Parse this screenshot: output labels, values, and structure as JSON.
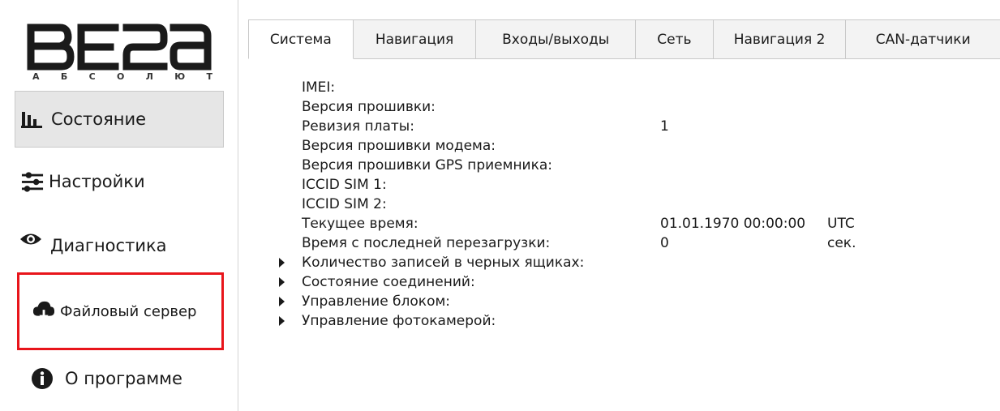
{
  "logo": {
    "brand": "ВЕГА",
    "tagline_letters": [
      "А",
      "Б",
      "С",
      "О",
      "Л",
      "Ю",
      "Т"
    ]
  },
  "colors": {
    "highlight": "#e8151b",
    "active_bg": "#e6e6e6"
  },
  "sidebar": {
    "items": [
      {
        "label": "Состояние",
        "icon": "bar-chart-icon",
        "active": true
      },
      {
        "label": "Настройки",
        "icon": "sliders-icon"
      },
      {
        "label": "Диагностика",
        "icon": "eye-icon"
      },
      {
        "label": "Файловый сервер",
        "icon": "cloud-download-icon",
        "highlighted": true
      },
      {
        "label": "О программе",
        "icon": "info-icon"
      }
    ]
  },
  "tabs": [
    "Система",
    "Навигация",
    "Входы/выходы",
    "Сеть",
    "Навигация 2",
    "CAN-датчики"
  ],
  "active_tab": "Система",
  "system": {
    "imei": {
      "label": "IMEI:",
      "value": ""
    },
    "firmware": {
      "label": "Версия прошивки:",
      "value": ""
    },
    "board_revision": {
      "label": "Ревизия платы:",
      "value": "1"
    },
    "modem_firmware": {
      "label": "Версия прошивки модема:",
      "value": ""
    },
    "gps_firmware": {
      "label": "Версия прошивки GPS приемника:",
      "value": ""
    },
    "iccid_sim1": {
      "label": "ICCID SIM 1:",
      "value": ""
    },
    "iccid_sim2": {
      "label": "ICCID SIM 2:",
      "value": ""
    },
    "current_time": {
      "label": "Текущее время:",
      "value": "01.01.1970 00:00:00",
      "unit": "UTC"
    },
    "uptime": {
      "label": "Время с последней перезагрузки:",
      "value": "0",
      "unit": "сек."
    }
  },
  "groups": [
    "Количество записей в черных ящиках:",
    "Состояние соединений:",
    "Управление блоком:",
    "Управление фотокамерой:"
  ]
}
